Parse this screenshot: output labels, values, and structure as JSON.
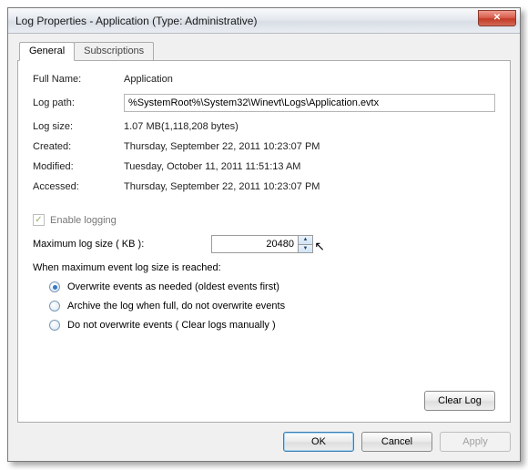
{
  "window": {
    "title": "Log Properties - Application (Type: Administrative)"
  },
  "tabs": {
    "general": "General",
    "subscriptions": "Subscriptions"
  },
  "labels": {
    "full_name": "Full Name:",
    "log_path": "Log path:",
    "log_size": "Log size:",
    "created": "Created:",
    "modified": "Modified:",
    "accessed": "Accessed:",
    "enable_logging": "Enable logging",
    "max_size": "Maximum log size ( KB ):",
    "when_max": "When maximum event log size is reached:"
  },
  "values": {
    "full_name": "Application",
    "log_path": "%SystemRoot%\\System32\\Winevt\\Logs\\Application.evtx",
    "log_size": "1.07 MB(1,118,208 bytes)",
    "created": "Thursday, September 22, 2011 10:23:07 PM",
    "modified": "Tuesday, October 11, 2011 11:51:13 AM",
    "accessed": "Thursday, September 22, 2011 10:23:07 PM",
    "max_size": "20480"
  },
  "radios": {
    "overwrite": "Overwrite events as needed (oldest events first)",
    "archive": "Archive the log when full, do not overwrite events",
    "noclear": "Do not overwrite events ( Clear logs manually )"
  },
  "buttons": {
    "clear_log": "Clear Log",
    "ok": "OK",
    "cancel": "Cancel",
    "apply": "Apply"
  }
}
